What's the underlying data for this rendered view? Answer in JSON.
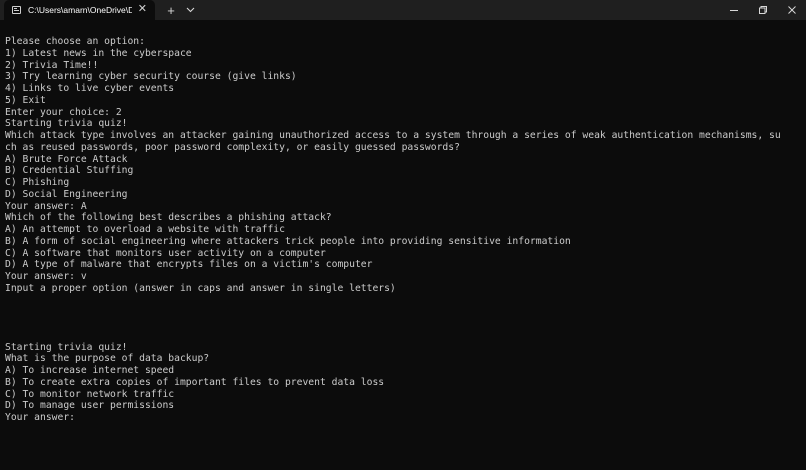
{
  "titlebar": {
    "tab_title": "C:\\Users\\amarn\\OneDrive\\De",
    "tab_close_glyph": "✕",
    "new_tab_glyph": "+"
  },
  "terminal": {
    "lines": [
      "Please choose an option:",
      "1) Latest news in the cyberspace",
      "2) Trivia Time!!",
      "3) Try learning cyber security course (give links)",
      "4) Links to live cyber events",
      "5) Exit",
      "Enter your choice: 2",
      "Starting trivia quiz!",
      "Which attack type involves an attacker gaining unauthorized access to a system through a series of weak authentication mechanisms, su",
      "ch as reused passwords, poor password complexity, or easily guessed passwords?",
      "A) Brute Force Attack",
      "B) Credential Stuffing",
      "C) Phishing",
      "D) Social Engineering",
      "Your answer: A",
      "Which of the following best describes a phishing attack?",
      "A) An attempt to overload a website with traffic",
      "B) A form of social engineering where attackers trick people into providing sensitive information",
      "C) A software that monitors user activity on a computer",
      "D) A type of malware that encrypts files on a victim's computer",
      "Your answer: v",
      "Input a proper option (answer in caps and answer in single letters)",
      "",
      "",
      "",
      "",
      "Starting trivia quiz!",
      "What is the purpose of data backup?",
      "A) To increase internet speed",
      "B) To create extra copies of important files to prevent data loss",
      "C) To monitor network traffic",
      "D) To manage user permissions",
      "Your answer:"
    ]
  }
}
